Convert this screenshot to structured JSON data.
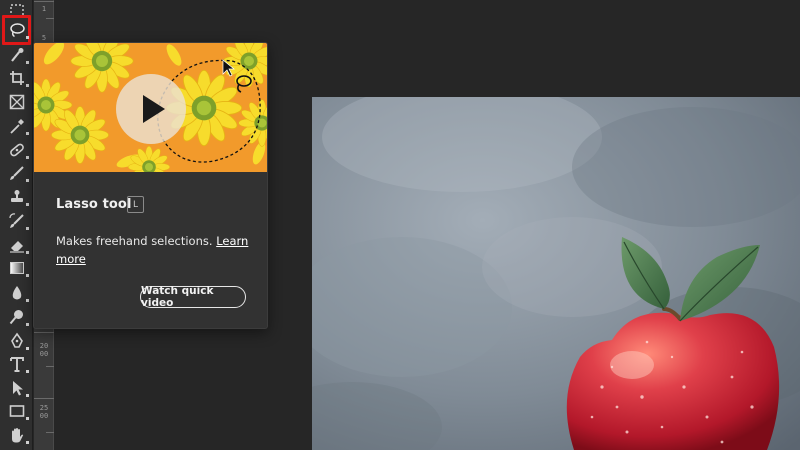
{
  "toolbar": {
    "tools": [
      {
        "icon": "marquee-tool-icon"
      },
      {
        "icon": "lasso-tool-icon",
        "selected": true
      },
      {
        "icon": "quick-selection-tool-icon"
      },
      {
        "icon": "crop-tool-icon"
      },
      {
        "icon": "frame-tool-icon"
      },
      {
        "icon": "eyedropper-tool-icon"
      },
      {
        "icon": "spot-healing-brush-icon"
      },
      {
        "icon": "brush-tool-icon"
      },
      {
        "icon": "clone-stamp-tool-icon"
      },
      {
        "icon": "history-brush-tool-icon"
      },
      {
        "icon": "eraser-tool-icon"
      },
      {
        "icon": "gradient-tool-icon"
      },
      {
        "icon": "blur-tool-icon"
      },
      {
        "icon": "dodge-tool-icon"
      },
      {
        "icon": "pen-tool-icon"
      },
      {
        "icon": "type-tool-icon"
      },
      {
        "icon": "path-selection-tool-icon"
      },
      {
        "icon": "rectangle-tool-icon"
      },
      {
        "icon": "hand-tool-icon"
      }
    ]
  },
  "ruler": {
    "labels": [
      "1",
      "5",
      "2000",
      "2500"
    ]
  },
  "tooltip": {
    "title": "Lasso tool",
    "shortcut": "L",
    "description": "Makes freehand selections.",
    "learn_more": "Learn more",
    "watch_button": "Watch quick video"
  },
  "colors": {
    "highlight": "#e01818",
    "panel_bg": "#323232",
    "workspace_bg": "#262626",
    "media_orange": "#f29a2b"
  }
}
